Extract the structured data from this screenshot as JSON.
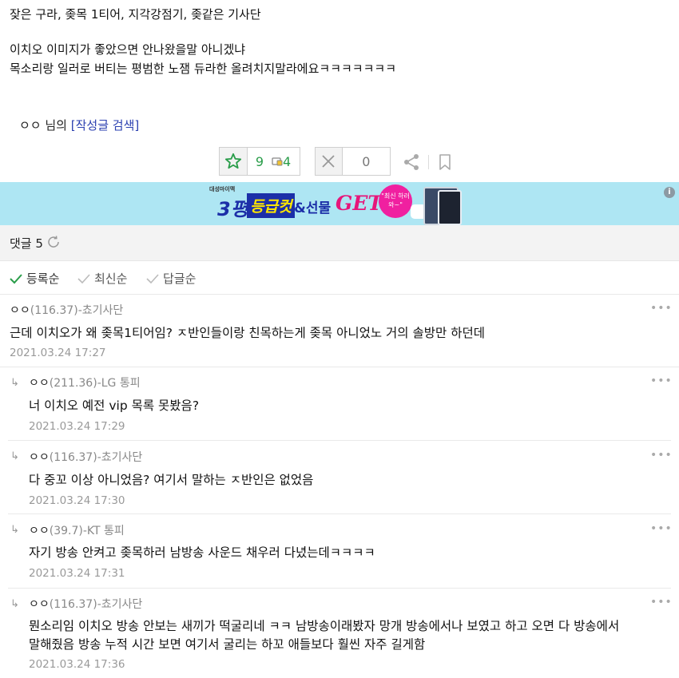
{
  "post": {
    "lines": [
      "잦은 구라, 좆목 1티어, 지각강점기, 좆같은 기사단",
      "이치오 이미지가 좋았으면 안나왔을말 아니겠냐",
      "목소리랑 일러로 버티는 평범한 노잼 듀라한 올려치지말라에요ㅋㅋㅋㅋㅋㅋㅋ"
    ]
  },
  "author_line": {
    "name": "ㅇㅇ 님의",
    "search_link": "[작성글 검색]"
  },
  "votes": {
    "up_count": "9",
    "mobile_count": "4",
    "down_count": "0"
  },
  "icons": {
    "upvote": "star-thumb-icon",
    "mobile": "mobile-icon",
    "downvote": "x-icon",
    "share": "share-icon",
    "bookmark": "bookmark-icon",
    "refresh": "refresh-icon",
    "check": "check-icon",
    "more": "more-icon",
    "reply": "reply-arrow-icon",
    "info": "info-icon"
  },
  "banner": {
    "brand": "대성마이맥",
    "number": "3평",
    "grade_cut": "등급컷",
    "gift": "&선물",
    "get": "GET!",
    "circle_text": "\"최신 하러 와~\"",
    "info": "i"
  },
  "comments_header": {
    "label": "댓글 5"
  },
  "sort_options": [
    "등록순",
    "최신순",
    "답글순"
  ],
  "comments": [
    {
      "nick": "ㅇㅇ",
      "ip": "(116.37)",
      "tag": "-쵸기사단",
      "text": "근데 이치오가 왜 좆목1티어임? ㅈ반인들이랑 친목하는게 좆목 아니었노 거의 솔방만 하던데",
      "date": "2021.03.24 17:27"
    },
    {
      "nick": "ㅇㅇ",
      "ip": "(211.36)",
      "tag": "-LG 통피",
      "text": "너 이치오 예전 vip 목록 못봤음?",
      "date": "2021.03.24 17:29"
    },
    {
      "nick": "ㅇㅇ",
      "ip": "(116.37)",
      "tag": "-쵸기사단",
      "text": "다 중꼬 이상 아니었음? 여기서 말하는 ㅈ반인은 없었음",
      "date": "2021.03.24 17:30"
    },
    {
      "nick": "ㅇㅇ",
      "ip": "(39.7)",
      "tag": "-KT 통피",
      "text": "자기 방송 안켜고 좆목하러 남방송 사운드 채우러 다녔는데ㅋㅋㅋㅋ",
      "date": "2021.03.24 17:31"
    },
    {
      "nick": "ㅇㅇ",
      "ip": "(116.37)",
      "tag": "-쵸기사단",
      "text": "뭔소리임 이치오 방송 안보는 새끼가 떡굴리네 ㅋㅋ 남방송이래봤자 망개 방송에서나 보였고 하고 오면 다 방송에서",
      "text2": "말해줬음 방송 누적 시간 보면 여기서 굴리는 하꼬 애들보다 훨씬 자주 길게함",
      "date": "2021.03.24 17:36"
    }
  ],
  "colors": {
    "accent_green": "#2a9d4a",
    "link_blue": "#2a3fb0",
    "banner_bg": "#aee6f3",
    "date_gray": "#999999"
  }
}
